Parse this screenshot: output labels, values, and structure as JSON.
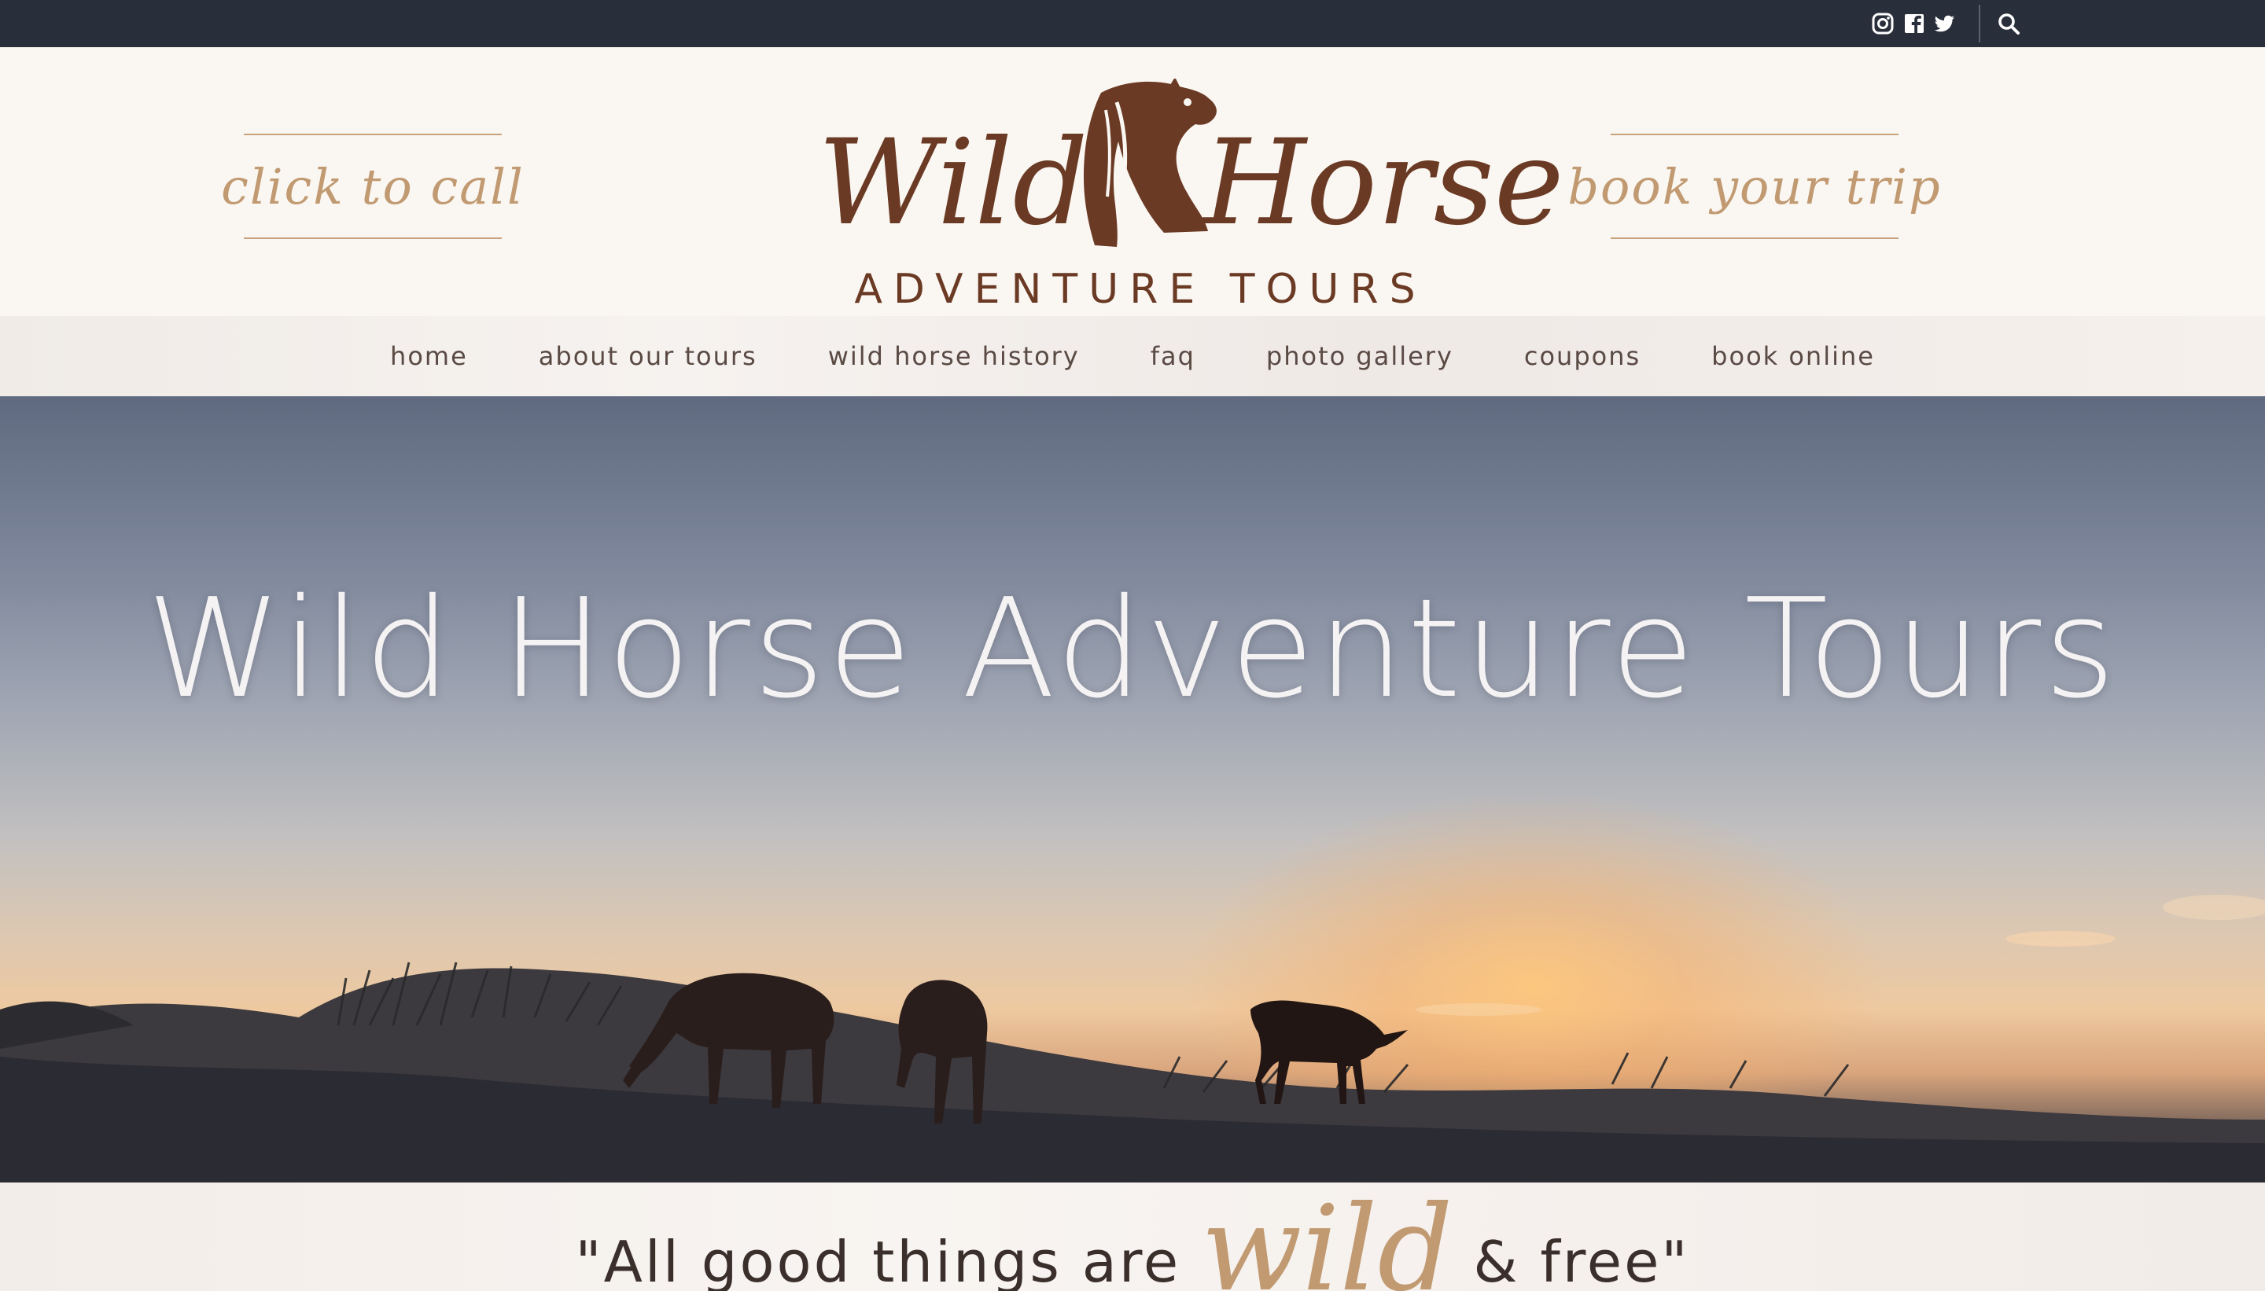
{
  "topbar": {
    "icons": [
      "instagram-icon",
      "facebook-icon",
      "twitter-icon",
      "search-icon"
    ]
  },
  "header": {
    "call_label": "click to call",
    "book_label": "book your trip",
    "logo": {
      "script_left": "Wild",
      "script_right": "Horse",
      "subtitle": "ADVENTURE TOURS"
    }
  },
  "nav": {
    "items": [
      {
        "label": "home"
      },
      {
        "label": "about our tours"
      },
      {
        "label": "wild horse history"
      },
      {
        "label": "faq"
      },
      {
        "label": "photo gallery"
      },
      {
        "label": "coupons"
      },
      {
        "label": "book online"
      }
    ]
  },
  "hero": {
    "title": "Wild Horse Adventure Tours"
  },
  "quote": {
    "before": "\"All good things are ",
    "accent": "wild",
    "after": " & free\""
  },
  "colors": {
    "topbar": "#282e3a",
    "brand_brown": "#6b3a24",
    "accent_tan": "#c19a72",
    "nav_text": "#5a4a44"
  }
}
